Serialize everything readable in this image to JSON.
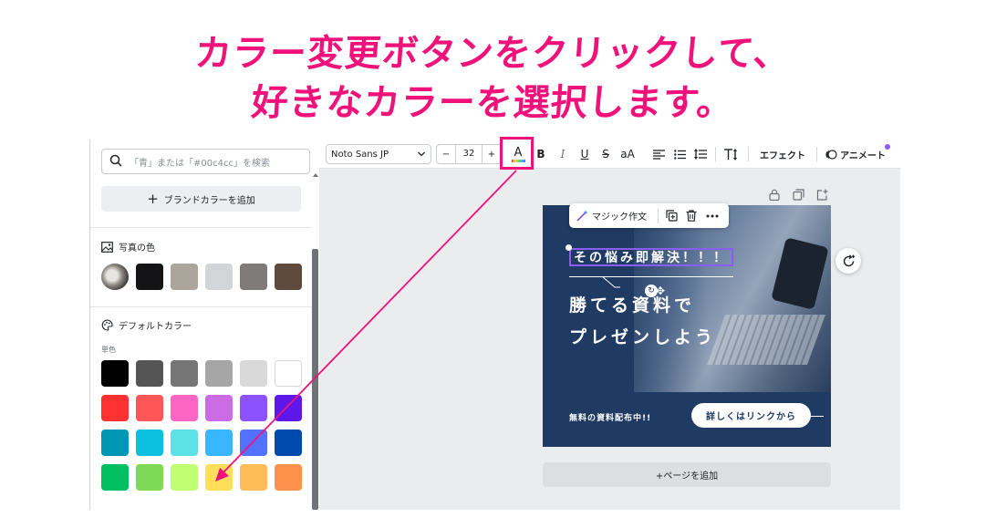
{
  "headline": {
    "line1": "カラー変更ボタンをクリックして、",
    "line2": "好きなカラーを選択します。"
  },
  "panel": {
    "search_placeholder": "「青」または「#00c4cc」を検索",
    "brand_button": "ブランドカラーを追加",
    "photo_section": "写真の色",
    "photo_colors": [
      "#141416",
      "#aba59c",
      "#d2d6d9",
      "#7f7b7b",
      "#5f4a3e"
    ],
    "default_section": "デフォルトカラー",
    "solid_label": "単色",
    "default_colors": [
      [
        "#000000",
        "#555555",
        "#767676",
        "#a6a6a6",
        "#d9d9d9",
        "#ffffff"
      ],
      [
        "#ff3131",
        "#ff5757",
        "#ff66c4",
        "#cb6ce6",
        "#8c52ff",
        "#5e17eb"
      ],
      [
        "#0097b2",
        "#0cc0df",
        "#5ce1e6",
        "#38b6ff",
        "#5271ff",
        "#004aad"
      ],
      [
        "#00bf63",
        "#7ed957",
        "#c1ff72",
        "#ffde59",
        "#ffbd59",
        "#ff914d"
      ]
    ]
  },
  "toolbar": {
    "font": "Noto Sans JP",
    "size": "32",
    "minus": "−",
    "plus": "+",
    "color_letter": "A",
    "bold": "B",
    "italic": "I",
    "underline": "U",
    "strike": "S",
    "case": "aA",
    "effects": "エフェクト",
    "animate": "アニメート"
  },
  "magic_bar": {
    "label": "マジック作文"
  },
  "card": {
    "tag": "その悩み即解決！！！",
    "line_a": "勝てる資料で",
    "line_b": "プレゼンしよう",
    "distribution": "無料の資料配布中!!",
    "button": "詳しくはリンクから"
  },
  "add_page": "+ページを追加",
  "colors": {
    "accent": "#f0127a",
    "card_bg": "#1f3a63",
    "selection": "#8b5cf6"
  }
}
